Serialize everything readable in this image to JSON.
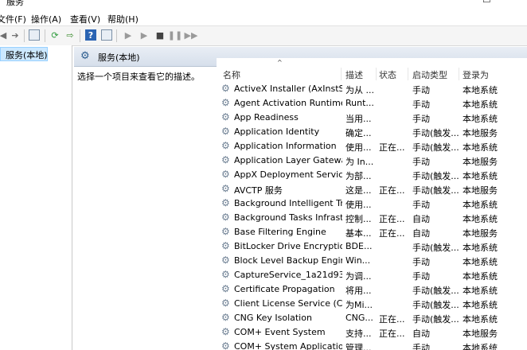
{
  "window": {
    "title": "服务"
  },
  "menu": [
    "文件(F)",
    "操作(A)",
    "查看(V)",
    "帮助(H)"
  ],
  "toolbar": {
    "icons": [
      "back-arrow-icon",
      "forward-arrow-icon",
      "console-tree-icon",
      "refresh-icon",
      "export-icon",
      "help-icon",
      "properties-icon",
      "start-icon",
      "play-icon",
      "stop-icon",
      "pause-icon",
      "restart-icon"
    ]
  },
  "tree": {
    "selected": "服务(本地)"
  },
  "pane": {
    "title": "服务(本地)",
    "description": "选择一个项目来查看它的描述。"
  },
  "columns": {
    "name": "名称",
    "desc": "描述",
    "status": "状态",
    "startup": "启动类型",
    "logon": "登录为"
  },
  "services": [
    {
      "name": "ActiveX Installer (AxInstSV)",
      "desc": "为从 ...",
      "status": "",
      "startup": "手动",
      "logon": "本地系统"
    },
    {
      "name": "Agent Activation Runtime_...",
      "desc": "Runt...",
      "status": "",
      "startup": "手动",
      "logon": "本地系统"
    },
    {
      "name": "App Readiness",
      "desc": "当用...",
      "status": "",
      "startup": "手动",
      "logon": "本地系统"
    },
    {
      "name": "Application Identity",
      "desc": "确定...",
      "status": "",
      "startup": "手动(触发...",
      "logon": "本地服务"
    },
    {
      "name": "Application Information",
      "desc": "使用...",
      "status": "正在...",
      "startup": "手动(触发...",
      "logon": "本地系统"
    },
    {
      "name": "Application Layer Gateway ...",
      "desc": "为 In...",
      "status": "",
      "startup": "手动",
      "logon": "本地服务"
    },
    {
      "name": "AppX Deployment Service ...",
      "desc": "为部...",
      "status": "",
      "startup": "手动(触发...",
      "logon": "本地系统"
    },
    {
      "name": "AVCTP 服务",
      "desc": "这是...",
      "status": "正在...",
      "startup": "手动(触发...",
      "logon": "本地服务"
    },
    {
      "name": "Background Intelligent Tra...",
      "desc": "使用...",
      "status": "",
      "startup": "手动",
      "logon": "本地系统"
    },
    {
      "name": "Background Tasks Infrastru...",
      "desc": "控制...",
      "status": "正在...",
      "startup": "自动",
      "logon": "本地系统"
    },
    {
      "name": "Base Filtering Engine",
      "desc": "基本...",
      "status": "正在...",
      "startup": "自动",
      "logon": "本地服务"
    },
    {
      "name": "BitLocker Drive Encryption ...",
      "desc": "BDE...",
      "status": "",
      "startup": "手动(触发...",
      "logon": "本地系统"
    },
    {
      "name": "Block Level Backup Engine ...",
      "desc": "Win...",
      "status": "",
      "startup": "手动",
      "logon": "本地系统"
    },
    {
      "name": "CaptureService_1a21d934",
      "desc": "为调...",
      "status": "",
      "startup": "手动",
      "logon": "本地系统"
    },
    {
      "name": "Certificate Propagation",
      "desc": "将用...",
      "status": "",
      "startup": "手动(触发...",
      "logon": "本地系统"
    },
    {
      "name": "Client License Service (Clip...",
      "desc": "为Mi...",
      "status": "",
      "startup": "手动(触发...",
      "logon": "本地系统"
    },
    {
      "name": "CNG Key Isolation",
      "desc": "CNG...",
      "status": "正在...",
      "startup": "手动(触发...",
      "logon": "本地系统"
    },
    {
      "name": "COM+ Event System",
      "desc": "支持...",
      "status": "正在...",
      "startup": "自动",
      "logon": "本地服务"
    },
    {
      "name": "COM+ System Application",
      "desc": "管理...",
      "status": "",
      "startup": "手动",
      "logon": "本地系统"
    }
  ]
}
